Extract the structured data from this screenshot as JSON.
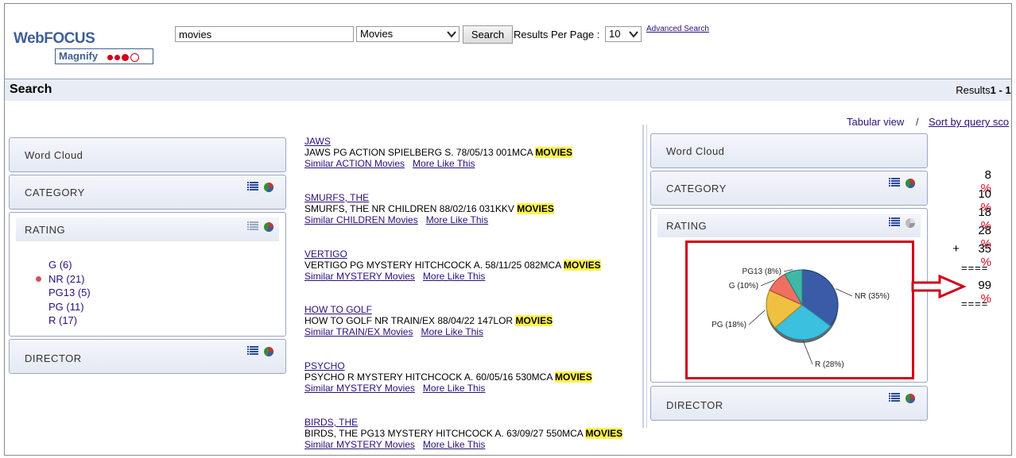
{
  "header": {
    "logo_main": "WebFOCUS",
    "logo_sub": "Magnify",
    "search_value": "movies",
    "category_selected": "Movies",
    "search_button": "Search",
    "results_per_page_label": "Results Per Page :",
    "results_per_page_value": "10",
    "advanced_search": "Advanced Search"
  },
  "titlebar": {
    "title": "Search",
    "results_prefix": "Results",
    "results_range": "1 - 1("
  },
  "facets_left": {
    "word_cloud": "Word Cloud",
    "category": "CATEGORY",
    "rating": "RATING",
    "director": "DIRECTOR",
    "rating_items": [
      "G (6)",
      "NR (21)",
      "PG13 (5)",
      "PG (11)",
      "R (17)"
    ]
  },
  "results": [
    {
      "title": "JAWS",
      "desc": "JAWS PG ACTION SPIELBERG S. 78/05/13 001MCA",
      "hit": "MOVIES",
      "similar": "Similar ACTION Movies",
      "more": "More Like This"
    },
    {
      "title": "SMURFS, THE",
      "desc": "SMURFS, THE NR CHILDREN 88/02/16 031KKV",
      "hit": "MOVIES",
      "similar": "Similar CHILDREN Movies",
      "more": "More Like This"
    },
    {
      "title": "VERTIGO",
      "desc": "VERTIGO PG MYSTERY HITCHCOCK A. 58/11/25 082MCA",
      "hit": "MOVIES",
      "similar": "Similar MYSTERY Movies",
      "more": "More Like This"
    },
    {
      "title": "HOW TO GOLF",
      "desc": "HOW TO GOLF NR TRAIN/EX 88/04/22 147LOR",
      "hit": "MOVIES",
      "similar": "Similar TRAIN/EX Movies",
      "more": "More Like This"
    },
    {
      "title": "PSYCHO",
      "desc": "PSYCHO R MYSTERY HITCHCOCK A. 60/05/16 530MCA",
      "hit": "MOVIES",
      "similar": "Similar MYSTERY Movies",
      "more": "More Like This"
    },
    {
      "title": "BIRDS, THE",
      "desc": "BIRDS, THE PG13 MYSTERY HITCHCOCK A. 63/09/27 550MCA",
      "hit": "MOVIES",
      "similar": "Similar MYSTERY Movies",
      "more": "More Like This"
    }
  ],
  "view_links": {
    "tabular": "Tabular view",
    "separator": "/",
    "sort": "Sort by query sco"
  },
  "facets_right": {
    "word_cloud": "Word Cloud",
    "category": "CATEGORY",
    "rating": "RATING",
    "director": "DIRECTOR"
  },
  "chart_data": {
    "type": "pie",
    "title": "",
    "slices": [
      {
        "label": "NR (35%)",
        "value": 35,
        "color": "#3a5ba8"
      },
      {
        "label": "R (28%)",
        "value": 28,
        "color": "#3bc0e0"
      },
      {
        "label": "PG (18%)",
        "value": 18,
        "color": "#f0c040"
      },
      {
        "label": "G (10%)",
        "value": 10,
        "color": "#f07060"
      },
      {
        "label": "PG13 (8%)",
        "value": 8,
        "color": "#40b8a8"
      }
    ]
  },
  "sum": {
    "rows": [
      {
        "prefix": "",
        "value": "8",
        "pct": "%"
      },
      {
        "prefix": "",
        "value": "10",
        "pct": "%"
      },
      {
        "prefix": "",
        "value": "18",
        "pct": "%"
      },
      {
        "prefix": "",
        "value": "28",
        "pct": "%"
      },
      {
        "prefix": "+",
        "value": "35",
        "pct": "%"
      }
    ],
    "equals": "====",
    "total": "99",
    "total_pct": "%"
  },
  "colors": {
    "accent_red": "#d0001b",
    "link": "#2b0f7a",
    "highlight": "#fff34d"
  }
}
